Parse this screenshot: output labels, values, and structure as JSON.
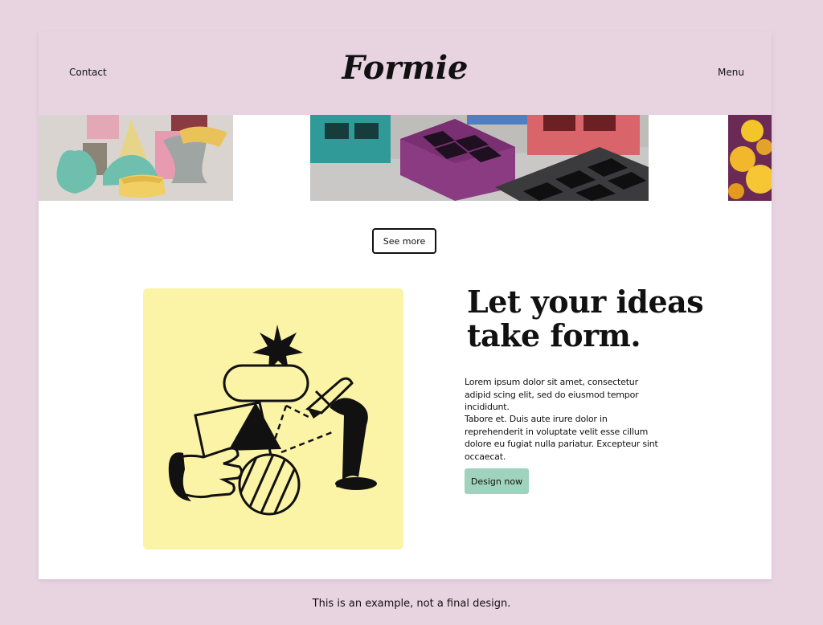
{
  "header": {
    "logo": "Formie",
    "contact_label": "Contact",
    "menu_label": "Menu",
    "background": "#e8d3e1"
  },
  "gallery": {
    "photos": [
      {
        "name": "candles-photo",
        "description_icon": "photo"
      },
      {
        "name": "trays-photo",
        "description_icon": "photo"
      },
      {
        "name": "flowers-photo",
        "description_icon": "photo"
      }
    ],
    "see_more_label": "See more"
  },
  "feature": {
    "headline": "Let your ideas take form.",
    "paragraph_1": "Lorem ipsum dolor sit amet, consectetur adipid scing elit, sed do eiusmod tempor incididunt.",
    "paragraph_2": "Tabore et. Duis aute irure dolor in reprehenderit in voluptate velit esse cillum dolore eu fugiat nulla pariatur. Excepteur sint occaecat.",
    "cta_label": "Design now",
    "cta_color": "#9fd3bd",
    "illustration_background": "#fbf3a6"
  },
  "footnote": "This is an example, not a final design."
}
